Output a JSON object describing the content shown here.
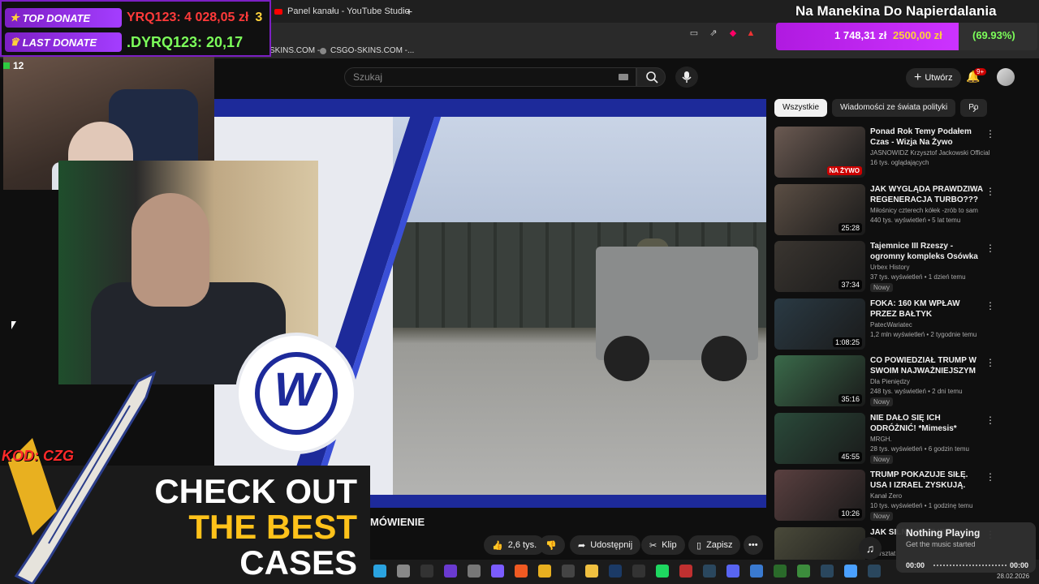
{
  "browser": {
    "tab_title": "Panel kanału - YouTube Studio",
    "new_tab": "+",
    "bookmarks": [
      "SKINS.COM -...",
      "CSGO-SKINS.COM -..."
    ]
  },
  "youtube": {
    "search_placeholder": "Szukaj",
    "create_label": "Utwórz",
    "notifications_badge": "9+",
    "video_title": "MÓWIENIE",
    "actions": {
      "like": "2,6 tys.",
      "share": "Udostępnij",
      "clip": "Klip",
      "save": "Zapisz",
      "more": "•••"
    },
    "chips": [
      "Wszystkie",
      "Wiadomości ze świata polityki",
      "Po"
    ],
    "recommendations": [
      {
        "title": "Ponad Rok Temy Podałem Czas - Wizja Na Żywo",
        "channel": "JASNOWIDZ Krzysztof Jackowski Official",
        "meta": "16 tys. oglądających",
        "badge": "",
        "duration": "",
        "live": "NA ŻYWO"
      },
      {
        "title": "JAK WYGLĄDA PRAWDZIWA REGENERACJA TURBO??? ...",
        "channel": "Miłośnicy czterech kółek -zrób to sam",
        "meta": "440 tys. wyświetleń • 5 lat temu",
        "badge": "",
        "duration": "25:28",
        "live": ""
      },
      {
        "title": "Tajemnice III Rzeszy - ogromny kompleks Osówka",
        "channel": "Urbex History",
        "meta": "37 tys. wyświetleń • 1 dzień temu",
        "badge": "Nowy",
        "duration": "37:34",
        "live": ""
      },
      {
        "title": "FOKA: 160 KM WPŁAW PRZEZ BAŁTYK",
        "channel": "PatecWariatec",
        "meta": "1,2 mln wyświetleń • 2 tygodnie temu",
        "badge": "",
        "duration": "1:08:25",
        "live": ""
      },
      {
        "title": "CO POWIEDZIAŁ TRUMP W SWOIM NAJWAŻNIEJSZYM ...",
        "channel": "Dla Pieniędzy",
        "meta": "248 tys. wyświetleń • 2 dni temu",
        "badge": "Nowy",
        "duration": "35:16",
        "live": ""
      },
      {
        "title": "NIE DAŁO SIĘ ICH ODRÓŻNIĆ! *Mimesis*",
        "channel": "MRGH.",
        "meta": "28 tys. wyświetleń • 6 godzin temu",
        "badge": "Nowy",
        "duration": "45:55",
        "live": ""
      },
      {
        "title": "TRUMP POKAZUJE SIŁĘ. USA I IZRAEL ZYSKUJĄ. IRAN, CHIN...",
        "channel": "Kanał Zero",
        "meta": "10 tys. wyświetleń • 1 godzinę temu",
        "badge": "Nowy",
        "duration": "10:26",
        "live": ""
      },
      {
        "title": "JAK SILNY JEST IRAN",
        "channel": "Warsztat",
        "meta": "",
        "badge": "",
        "duration": "",
        "live": ""
      }
    ]
  },
  "stream_overlay": {
    "top_donate_label": "TOP DONATE",
    "top_donate_value": "YRQ123: 4 028,05 zł",
    "top_donate_rank": "3",
    "last_donate_label": "LAST DONATE",
    "last_donate_value": ".DYRQ123: 20,17",
    "goal_title": "Na Manekina Do Napierdalania",
    "goal_current": "1 748,31 zł",
    "goal_target": "2500,00 zł",
    "goal_percent_label": "(69.93%)",
    "goal_fraction": 0.6993,
    "viewers": "12",
    "promo_code": "KOD: CZG",
    "ad_lines": [
      "CHECK OUT",
      "THE BEST",
      "CASES"
    ]
  },
  "music_widget": {
    "title": "Nothing Playing",
    "subtitle": "Get the music started",
    "time_start": "00:00",
    "time_end": "00:00"
  },
  "taskbar": {
    "date": "28.02.2026"
  },
  "colors": {
    "accent_purple": "#a43dff",
    "brand_blue": "#1d2a9a",
    "yt_red": "#cc0000"
  }
}
